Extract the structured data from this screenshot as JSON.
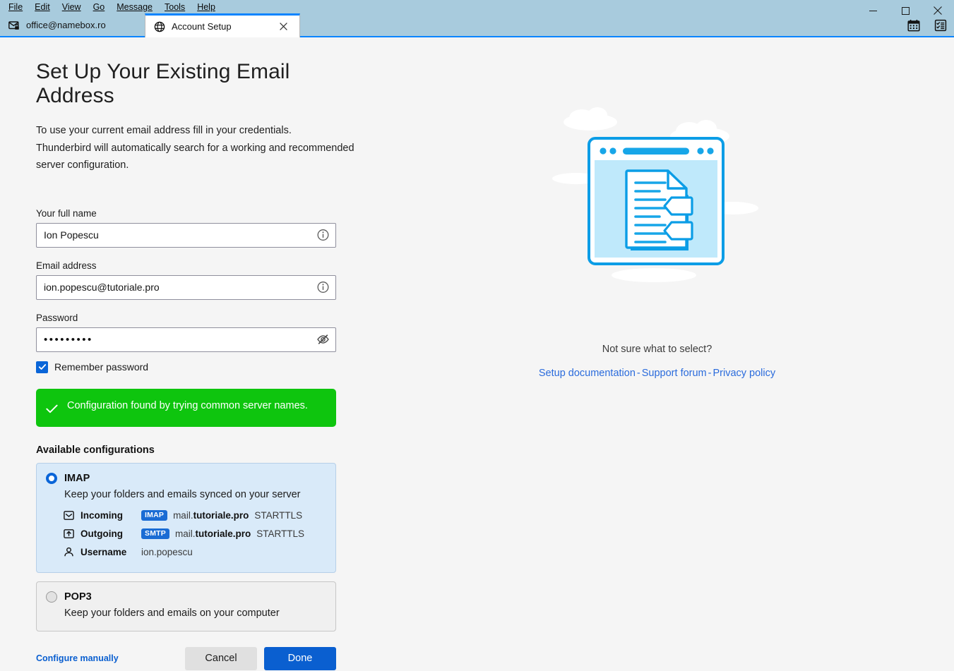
{
  "window": {
    "menu": [
      "File",
      "Edit",
      "View",
      "Go",
      "Message",
      "Tools",
      "Help"
    ],
    "controls": {
      "minimize": "minimize-button",
      "maximize": "maximize-button",
      "close": "close-button"
    }
  },
  "tabs": [
    {
      "label": "office@namebox.ro",
      "icon": "mail-lock-icon",
      "active": false,
      "closable": false
    },
    {
      "label": "Account Setup",
      "icon": "globe-icon",
      "active": true,
      "closable": true
    }
  ],
  "tabbar_icons": [
    {
      "name": "calendar-icon"
    },
    {
      "name": "tasks-icon"
    }
  ],
  "page": {
    "title": "Set Up Your Existing Email Address",
    "subtitle_line1": "To use your current email address fill in your credentials.",
    "subtitle_line2": "Thunderbird will automatically search for a working and recommended server configuration."
  },
  "form": {
    "name": {
      "label": "Your full name",
      "value": "Ion Popescu",
      "placeholder": "Your full name",
      "icon": "info-icon"
    },
    "email": {
      "label": "Email address",
      "value": "ion.popescu@tutoriale.pro",
      "placeholder": "Email address",
      "icon": "info-icon"
    },
    "password": {
      "label": "Password",
      "value": "•••••••••",
      "placeholder": "Password",
      "icon": "eye-slash-icon"
    },
    "remember": {
      "label": "Remember password",
      "checked": true
    }
  },
  "banner": {
    "icon": "check-icon",
    "text": "Configuration found by trying common server names.",
    "color": "#0ec50e"
  },
  "configurations": {
    "section_title": "Available configurations",
    "items": [
      {
        "id": "imap",
        "name": "IMAP",
        "description": "Keep your folders and emails synced on your server",
        "selected": true,
        "rows": [
          {
            "icon": "inbox-icon",
            "label": "Incoming",
            "badge": "IMAP",
            "host_prefix": "mail.",
            "host_main": "tutoriale.pro",
            "security": "STARTTLS"
          },
          {
            "icon": "outbox-icon",
            "label": "Outgoing",
            "badge": "SMTP",
            "host_prefix": "mail.",
            "host_main": "tutoriale.pro",
            "security": "STARTTLS"
          },
          {
            "icon": "person-icon",
            "label": "Username",
            "value": "ion.popescu"
          }
        ]
      },
      {
        "id": "pop3",
        "name": "POP3",
        "description": "Keep your folders and emails on your computer",
        "selected": false,
        "rows": []
      }
    ]
  },
  "actions": {
    "configure_manually": "Configure manually",
    "cancel": "Cancel",
    "done": "Done"
  },
  "sidebar_help": {
    "illustration": "document-window-illustration",
    "question": "Not sure what to select?",
    "links": [
      {
        "label": "Setup documentation"
      },
      {
        "label": "Support forum"
      },
      {
        "label": "Privacy policy"
      }
    ],
    "separator": "-"
  },
  "colors": {
    "titlebar": "#a8cbdd",
    "accent": "#0a5fd0",
    "tab_active_border": "#0a84ff",
    "banner_green": "#0ec50e",
    "card_selected_bg": "#d9eaf9"
  }
}
